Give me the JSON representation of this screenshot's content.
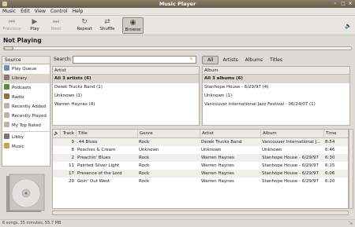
{
  "window": {
    "title": "Music Player"
  },
  "menu": [
    "Music",
    "Edit",
    "View",
    "Control",
    "Help"
  ],
  "toolbar": {
    "previous": "Previous",
    "play": "Play",
    "next": "Next",
    "repeat": "Repeat",
    "shuffle": "Shuffle",
    "browse": "Browse"
  },
  "now_playing": "Not Playing",
  "sources": {
    "header": "Source",
    "items": [
      {
        "label": "Play Queue",
        "icon": "queue-icon",
        "color": "#6d8fb8"
      },
      {
        "label": "Library",
        "icon": "library-icon",
        "color": "#8c7b68"
      },
      {
        "label": "Podcasts",
        "icon": "podcast-icon",
        "color": "#5a8a3a"
      },
      {
        "label": "Radio",
        "icon": "radio-icon",
        "color": "#9a6d3a"
      },
      {
        "label": "Recently Added",
        "icon": "playlist-icon",
        "color": "#b9b3a9"
      },
      {
        "label": "Recently Played",
        "icon": "playlist-icon",
        "color": "#b9b3a9"
      },
      {
        "label": "My Top Rated",
        "icon": "playlist-icon",
        "color": "#b9b3a9"
      },
      {
        "label": "Libby",
        "icon": "device-icon",
        "color": "#7a7570"
      },
      {
        "label": "Music",
        "icon": "folder-icon",
        "color": "#c9a24a"
      }
    ]
  },
  "search": {
    "label": "Search:",
    "value": ""
  },
  "filter_tabs": [
    "All",
    "Artists",
    "Albums",
    "Titles"
  ],
  "artist_pane": {
    "header": "Artist",
    "rows": [
      "All 3 artists (6)",
      "Derek Trucks Band (1)",
      "Unknown (1)",
      "Warren Haynes (4)"
    ]
  },
  "album_pane": {
    "header": "Album",
    "rows": [
      "All 3 albums (6)",
      "Stanhope House - 6/29/97 (4)",
      "Unknown (1)",
      "Vancouver International Jazz Festival - 06/24/07 (1)"
    ]
  },
  "tracks": {
    "headers": [
      "",
      "Track",
      "Title",
      "Genre",
      "Artist",
      "Album",
      "Time"
    ],
    "rows": [
      [
        "9",
        ".44 Blues",
        "Rock",
        "Derek Trucks Band",
        "Vancouver International J...",
        "8:54"
      ],
      [
        "8",
        "Peaches & Cream",
        "Unknown",
        "Unknown",
        "Unknown",
        "6:46"
      ],
      [
        "2",
        "Preachin' Blues",
        "Rock",
        "Warren Haynes",
        "Stanhope House - 6/29/97",
        "6:30"
      ],
      [
        "11",
        "Painted Silver Light",
        "Rock",
        "Warren Haynes",
        "Stanhope House - 6/29/97",
        "6:15"
      ],
      [
        "17",
        "Presence of the Lord",
        "Rock",
        "Warren Haynes",
        "Stanhope House - 6/29/97",
        "6:06"
      ],
      [
        "20",
        "Goin' Out West",
        "Rock",
        "Warren Haynes",
        "Stanhope House - 6/29/97",
        "6:20"
      ]
    ]
  },
  "status": "6 songs, 35 minutes, 55.7 MB"
}
